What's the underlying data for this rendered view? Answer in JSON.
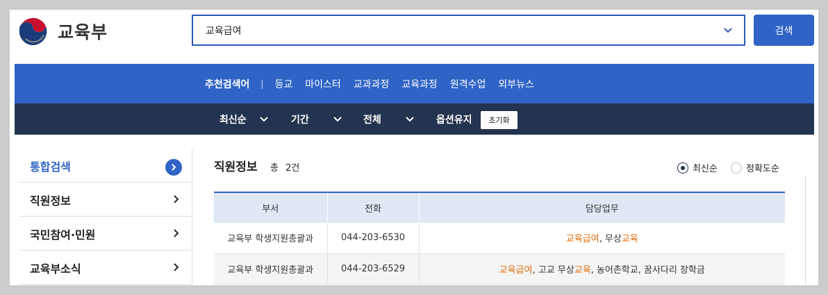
{
  "header": {
    "logo_text": "교육부",
    "search": {
      "value": "교육급여",
      "placeholder": ""
    },
    "search_button": "검색"
  },
  "recommended": {
    "title": "추천검색어",
    "separator": "|",
    "keywords": [
      "등교",
      "마이스터",
      "교과과정",
      "교육과정",
      "원격수업",
      "외부뉴스"
    ]
  },
  "options": {
    "sort": "최신순",
    "period": "기간",
    "scope": "전체",
    "keep": "옵션유지",
    "reset_button": "초기화"
  },
  "sidebar": {
    "items": [
      {
        "label": "통합검색",
        "active": true
      },
      {
        "label": "직원정보",
        "active": false
      },
      {
        "label": "국민참여·민원",
        "active": false
      },
      {
        "label": "교육부소식",
        "active": false
      }
    ]
  },
  "main": {
    "section_title": "직원정보",
    "total_label": "총",
    "total_count": "2건",
    "sort_options": [
      "최신순",
      "정확도순"
    ],
    "sort_selected": "최신순",
    "table": {
      "headers": [
        "부서",
        "전화",
        "담당업무"
      ],
      "rows": [
        {
          "dept": "교육부 학생지원총괄과",
          "phone": "044-203-6530",
          "duty": [
            {
              "text": "교육급여",
              "hl": true
            },
            {
              "text": ", 무상",
              "hl": false
            },
            {
              "text": "교육",
              "hl": true
            }
          ]
        },
        {
          "dept": "교육부 학생지원총괄과",
          "phone": "044-203-6529",
          "duty": [
            {
              "text": "교육급여",
              "hl": true
            },
            {
              "text": ", 고교 무상",
              "hl": false
            },
            {
              "text": "교육",
              "hl": true
            },
            {
              "text": ", 농어촌학교, 꿈사다리 장학금",
              "hl": false
            }
          ]
        }
      ]
    }
  },
  "colors": {
    "primary": "#2f64c6",
    "navy": "#233450",
    "highlight": "#e36c09",
    "header_row": "#dfe8f4"
  }
}
